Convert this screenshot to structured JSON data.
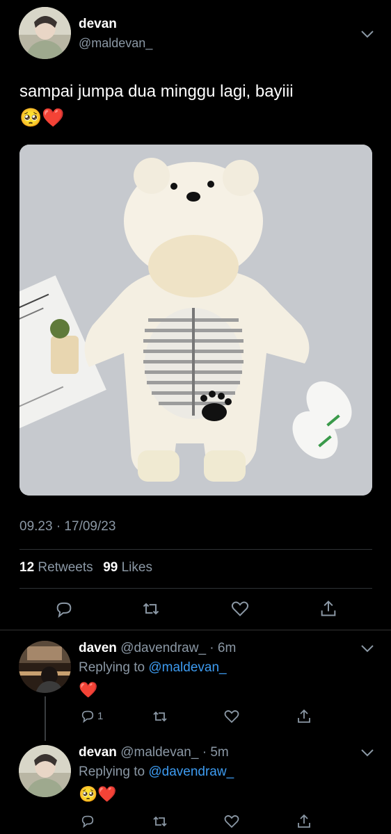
{
  "tweet": {
    "author_name": "devan",
    "author_handle": "@maldevan_",
    "text": "sampai jumpa dua minggu lagi, bayiii",
    "emojis": "🥺❤️",
    "timestamp": "09.23 · 17/09/23",
    "retweet_count": "12",
    "retweet_label": "Retweets",
    "like_count": "99",
    "like_label": "Likes",
    "media_icon": "baby-bear-romper-photo"
  },
  "replies": [
    {
      "author_name": "daven",
      "author_meta": "@davendraw_ · 6m",
      "replying_prefix": "Replying to",
      "replying_to": "@maldevan_",
      "emojis": "❤️",
      "reply_count": "1"
    },
    {
      "author_name": "devan",
      "author_meta": "@maldevan_ · 5m",
      "replying_prefix": "Replying to",
      "replying_to": "@davendraw_",
      "emojis": "🥺❤️"
    }
  ],
  "colors": {
    "background": "#000000",
    "text": "#e7e9ea",
    "muted": "#8b98a5",
    "link": "#3d9bf0",
    "heart": "#e0245e"
  }
}
